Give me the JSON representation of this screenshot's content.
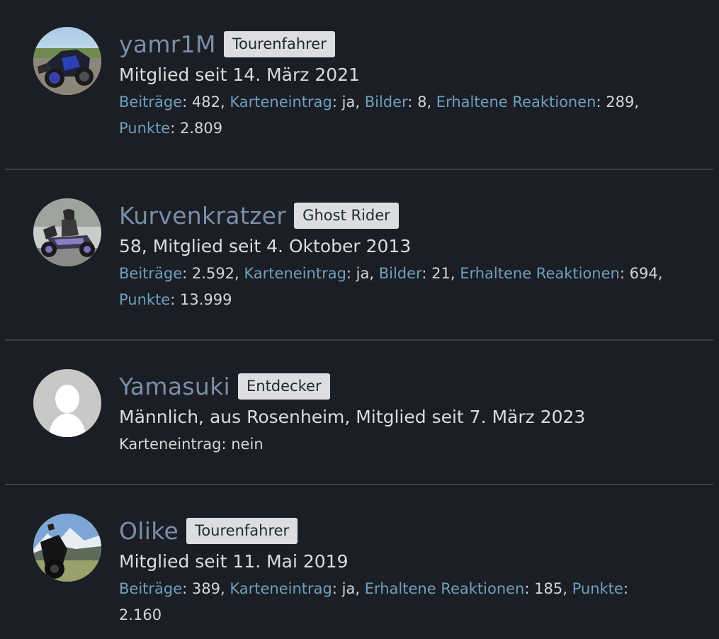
{
  "members": [
    {
      "username": "yamr1M",
      "title_badge": "Tourenfahrer",
      "blurb": "Mitglied seit 14. März 2021",
      "avatar": "motorcycle-photo-avatar",
      "stats": [
        {
          "key": "Beiträge",
          "value": "482"
        },
        {
          "key": "Karteneintrag",
          "value": "ja"
        },
        {
          "key": "Bilder",
          "value": "8"
        },
        {
          "key": "Erhaltene Reaktionen",
          "value": "289"
        },
        {
          "key": "Punkte",
          "value": "2.809"
        }
      ]
    },
    {
      "username": "Kurvenkratzer",
      "title_badge": "Ghost Rider",
      "blurb": "58, Mitglied seit 4. Oktober 2013",
      "avatar": "rider-on-motorcycle-avatar",
      "stats": [
        {
          "key": "Beiträge",
          "value": "2.592"
        },
        {
          "key": "Karteneintrag",
          "value": "ja"
        },
        {
          "key": "Bilder",
          "value": "21"
        },
        {
          "key": "Erhaltene Reaktionen",
          "value": "694"
        },
        {
          "key": "Punkte",
          "value": "13.999"
        }
      ]
    },
    {
      "username": "Yamasuki",
      "title_badge": "Entdecker",
      "blurb": "Männlich, aus Rosenheim, Mitglied seit 7. März 2023",
      "avatar": "default-user-avatar",
      "stats_plain": "Karteneintrag: nein"
    },
    {
      "username": "Olike",
      "title_badge": "Tourenfahrer",
      "blurb": "Mitglied seit 11. Mai 2019",
      "avatar": "motorcycle-mountain-avatar",
      "stats": [
        {
          "key": "Beiträge",
          "value": "389"
        },
        {
          "key": "Karteneintrag",
          "value": "ja"
        },
        {
          "key": "Erhaltene Reaktionen",
          "value": "185"
        },
        {
          "key": "Punkte",
          "value": "2.160"
        }
      ]
    }
  ],
  "colors": {
    "background": "#1b1e24",
    "username": "#7b8ea8",
    "stat_key": "#6f9fbd",
    "badge_bg": "#dcdde0",
    "divider": "#3a3e45"
  }
}
